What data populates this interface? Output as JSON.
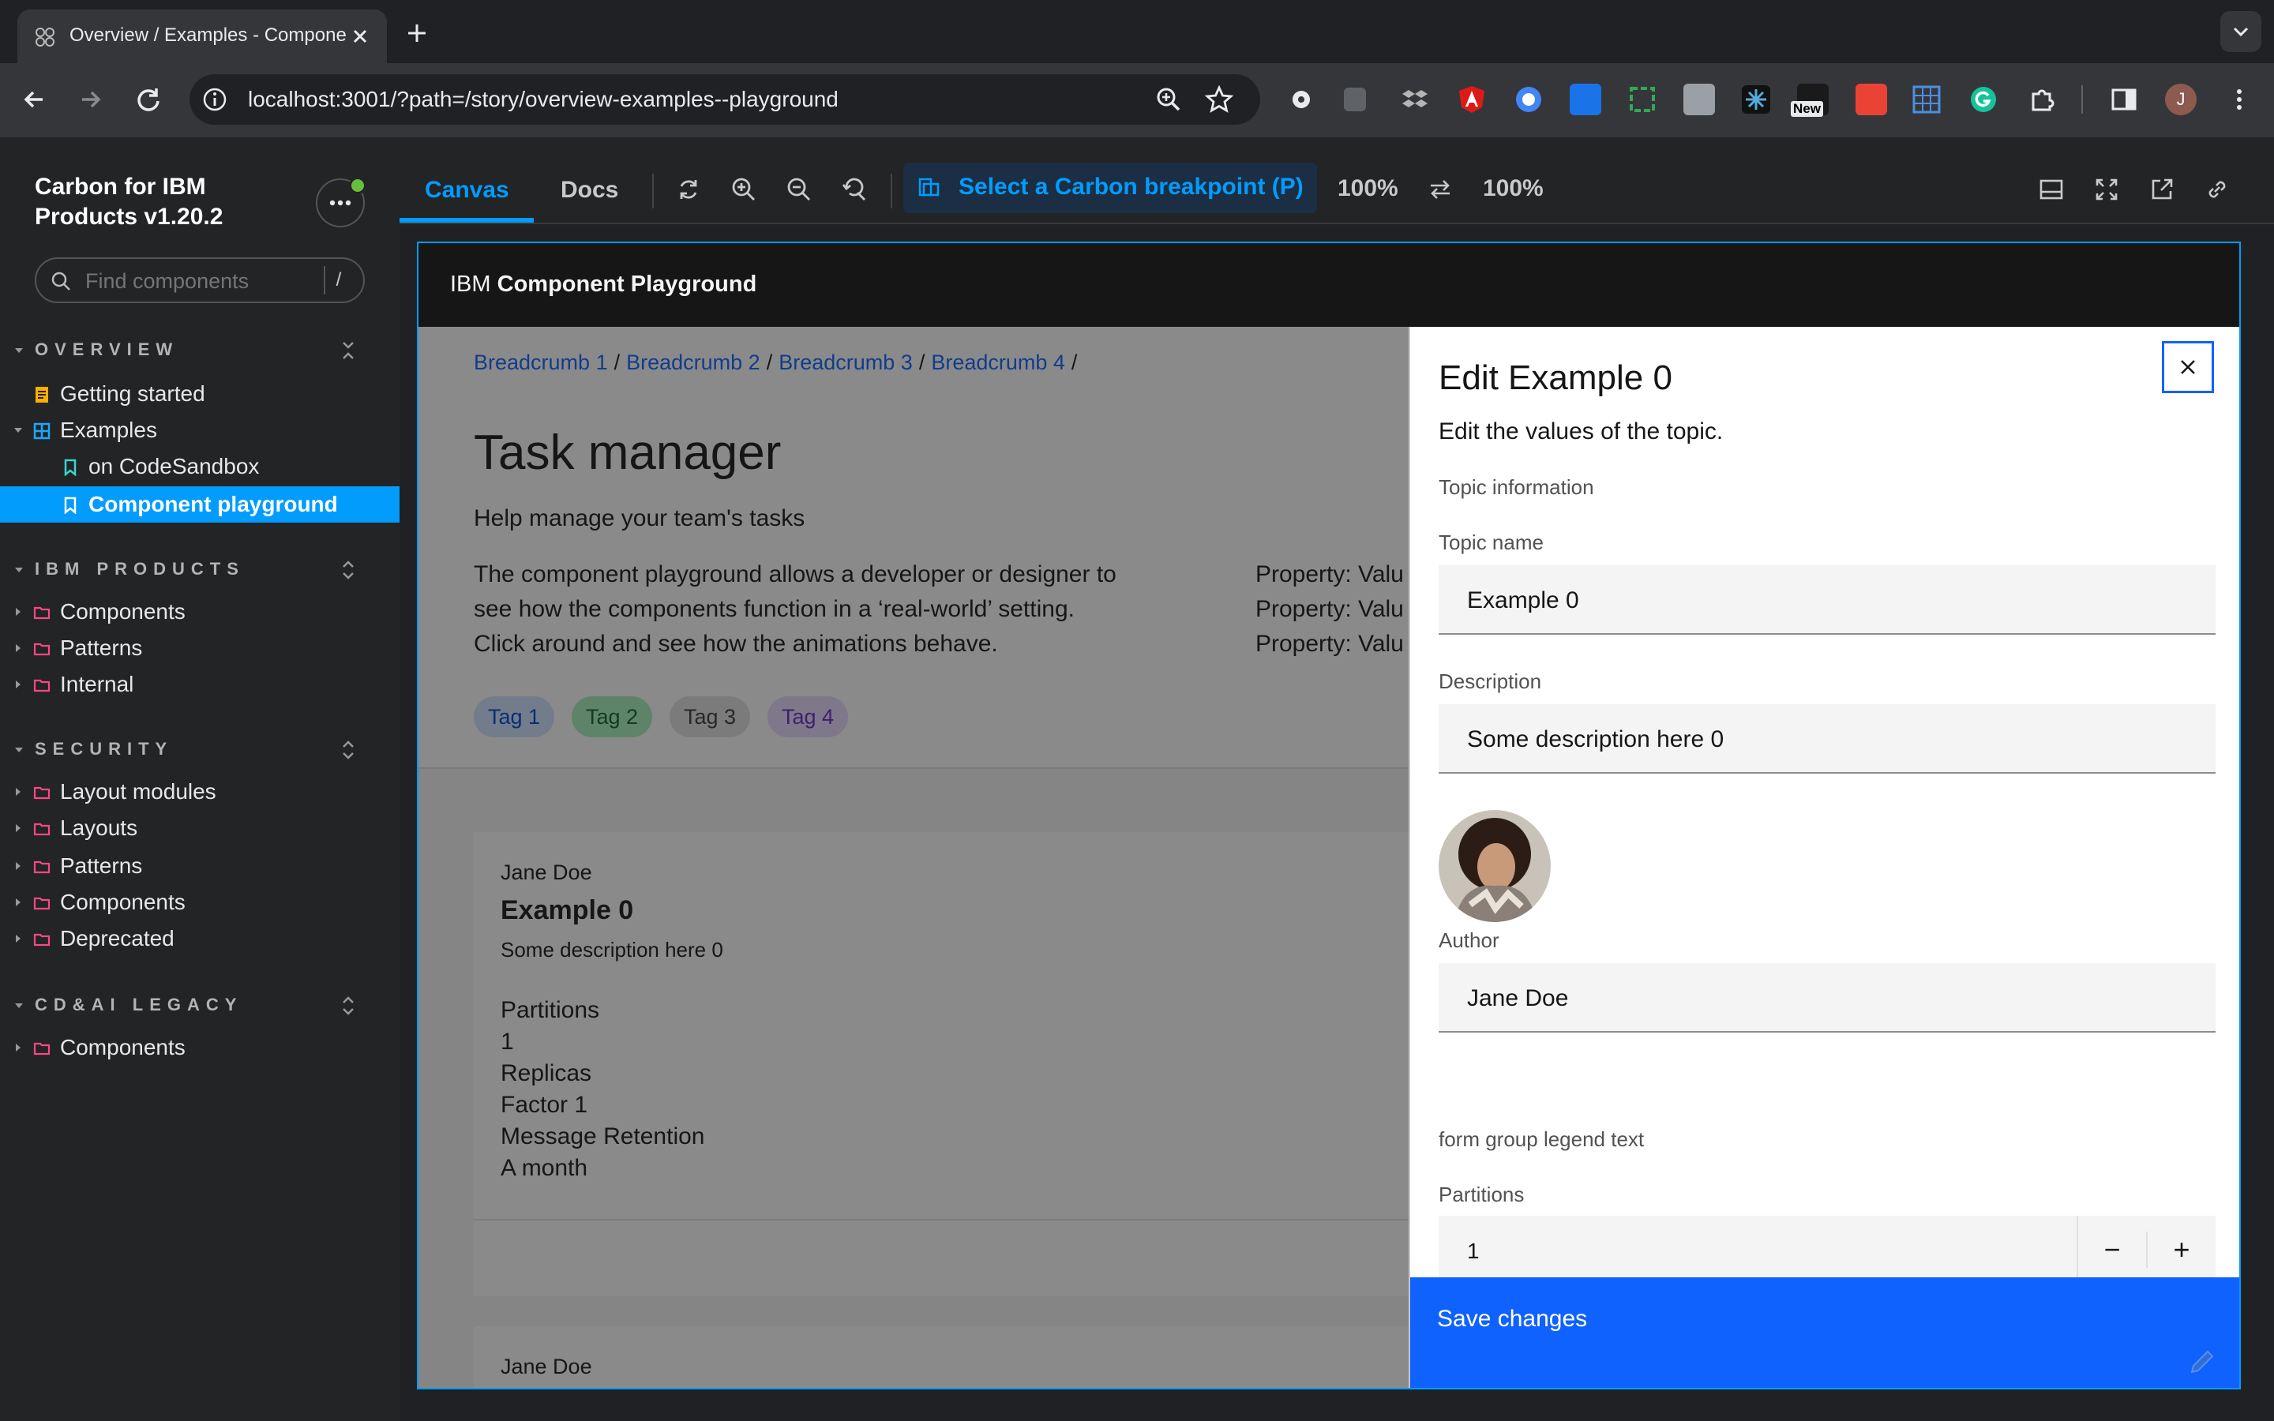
{
  "browser": {
    "tab_title": "Overview / Examples - Component playground",
    "url": "localhost:3001/?path=/story/overview-examples--playground",
    "new_badge": "New",
    "profile_initial": "J"
  },
  "sidebar": {
    "brand": "Carbon for IBM Products v1.20.2",
    "search_placeholder": "Find components",
    "search_shortcut": "/",
    "sections": {
      "overview": "OVERVIEW",
      "ibm_products": "IBM PRODUCTS",
      "security": "SECURITY",
      "cdai_legacy": "CD&AI LEGACY"
    },
    "items": {
      "getting_started": "Getting started",
      "examples": "Examples",
      "codesandbox": "on CodeSandbox",
      "playground": "Component playground",
      "ibm_components": "Components",
      "ibm_patterns": "Patterns",
      "ibm_internal": "Internal",
      "sec_layout_modules": "Layout modules",
      "sec_layouts": "Layouts",
      "sec_patterns": "Patterns",
      "sec_components": "Components",
      "sec_deprecated": "Deprecated",
      "cdai_components": "Components"
    }
  },
  "toolbar": {
    "canvas_tab": "Canvas",
    "docs_tab": "Docs",
    "breakpoint_label": "Select a Carbon breakpoint (P)",
    "zoom_width": "100%",
    "zoom_height": "100%"
  },
  "app": {
    "header_prefix": "IBM",
    "header_title": "Component Playground",
    "breadcrumbs": [
      "Breadcrumb 1",
      "Breadcrumb 2",
      "Breadcrumb 3",
      "Breadcrumb 4"
    ],
    "breadcrumb_sep": "/",
    "page_title": "Task manager",
    "page_subtitle": "Help manage your team's tasks",
    "description_lines": [
      "The component playground allows a developer or designer to",
      "see how the components function in a ‘real-world’ setting.",
      "Click around and see how the animations behave."
    ],
    "properties": [
      "Property: Valu",
      "Property: Valu",
      "Property: Valu"
    ],
    "tags": [
      {
        "label": "Tag 1",
        "bg": "#d0e2ff",
        "fg": "#0043ce"
      },
      {
        "label": "Tag 2",
        "bg": "#a7f0ba",
        "fg": "#0e6027"
      },
      {
        "label": "Tag 3",
        "bg": "#e0e0e0",
        "fg": "#393939"
      },
      {
        "label": "Tag 4",
        "bg": "#e8daff",
        "fg": "#6929c4"
      }
    ],
    "card": {
      "author": "Jane Doe",
      "name": "Example 0",
      "description": "Some description here 0",
      "lines": [
        "Partitions",
        "1",
        "Replicas",
        "Factor 1",
        "Message Retention",
        "A month"
      ]
    },
    "card2_author": "Jane Doe"
  },
  "panel": {
    "title": "Edit Example 0",
    "subtitle": "Edit the values of the topic.",
    "section_label": "Topic information",
    "topic_name_label": "Topic name",
    "topic_name_value": "Example 0",
    "description_label": "Description",
    "description_value": "Some description here 0",
    "author_label": "Author",
    "author_value": "Jane Doe",
    "legend_text": "form group legend text",
    "partitions_label": "Partitions",
    "partitions_value": "1",
    "decrement": "−",
    "increment": "+",
    "save_label": "Save changes"
  },
  "colors": {
    "storybook_accent": "#029cfd",
    "carbon_blue": "#0f62fe",
    "header_dark": "#161616"
  }
}
